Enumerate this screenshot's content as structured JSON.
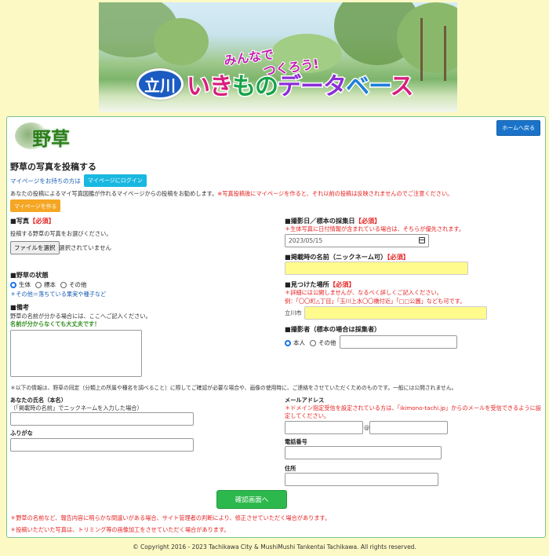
{
  "banner": {
    "line1": "みんなで",
    "line2": "つくろう!",
    "badge": "立川",
    "title_parts": [
      "いき",
      "もの",
      "データ",
      "ベー",
      "ス"
    ]
  },
  "card": {
    "home_button": "ホームへ戻る",
    "category_logo": "野草",
    "heading": "野草の写真を投稿する",
    "mypage_text": "マイページをお持ちの方は",
    "mypage_login": "マイページにログイン",
    "notice_text": "あなたの投稿によるマイ写真図鑑が作れるマイページからの投稿をお勧めします。",
    "notice_red": "※写真投稿後にマイページを作ると、それ以前の投稿は反映されませんのでご注意ください。",
    "mypage_create": "マイページを作る"
  },
  "left": {
    "photo": {
      "title": "■写真",
      "req": "【必須】",
      "hint": "投稿する野草の写真をお選びください。",
      "file_button": "ファイルを選択",
      "file_status": "選択されていません"
    },
    "state": {
      "title": "■野草の状態",
      "options": [
        "生体",
        "標本",
        "その他"
      ],
      "selected": 0,
      "note": "＊その他＝落ちている果実や種子など"
    },
    "remarks": {
      "title": "■備考",
      "hint": "野草の名前が分かる場合には、ここへご記入ください。",
      "hint2": "名前が分からなくても大丈夫です！"
    }
  },
  "right": {
    "date": {
      "title": "■撮影日／標本の採集日",
      "req": "【必須】",
      "note": "＊生体写真に日付情報が含まれている場合は、そちらが優先されます。",
      "value": "2023/05/15"
    },
    "nickname": {
      "title": "■掲載時の名前（ニックネーム可）",
      "req": "【必須】"
    },
    "place": {
      "title": "■見つけた場所",
      "req": "【必須】",
      "note1": "＊詳細には公開しませんが、なるべく詳しくご記入ください。",
      "note2": "例：「〇〇町△丁目」「玉川上水〇〇橋付近」「□□公園」なども可です。",
      "prefix": "立川市"
    },
    "photographer": {
      "title": "■撮影者（標本の場合は採集者）",
      "options": [
        "本人",
        "その他"
      ],
      "selected": 0
    }
  },
  "info_line": "＊以下の情報は、野草の同定（分類上の所属や種名を調べること）に際してご確認が必要な場合や、画像の使用時に、ご連絡をさせていただくためのものです。一般には公開されません。",
  "contact": {
    "name_label": "あなたの氏名（本名）",
    "name_hint": "（「掲載時の名前」でニックネームを入力した場合）",
    "furigana_label": "ふりがな",
    "email_label": "メールアドレス",
    "email_note": "＊ドメイン指定受信を設定されている方は、「ikimono-tachi.jp」からのメールを受信できるように設定してください。",
    "at": "@",
    "phone_label": "電話番号",
    "address_label": "住所"
  },
  "confirm_button": "確認画面へ",
  "bottom_notes": [
    "＊野草の名前など、報告内容に明らかな間違いがある場合、サイト管理者の判断により、修正させていただく場合があります。",
    "＊投稿いただいた写真は、トリミング等の画像加工をさせていただく場合があります。"
  ],
  "footer": "© Copyright 2016 - 2023 Tachikawa City & MushiMushi Tankentai Tachikawa. All rights reserved."
}
